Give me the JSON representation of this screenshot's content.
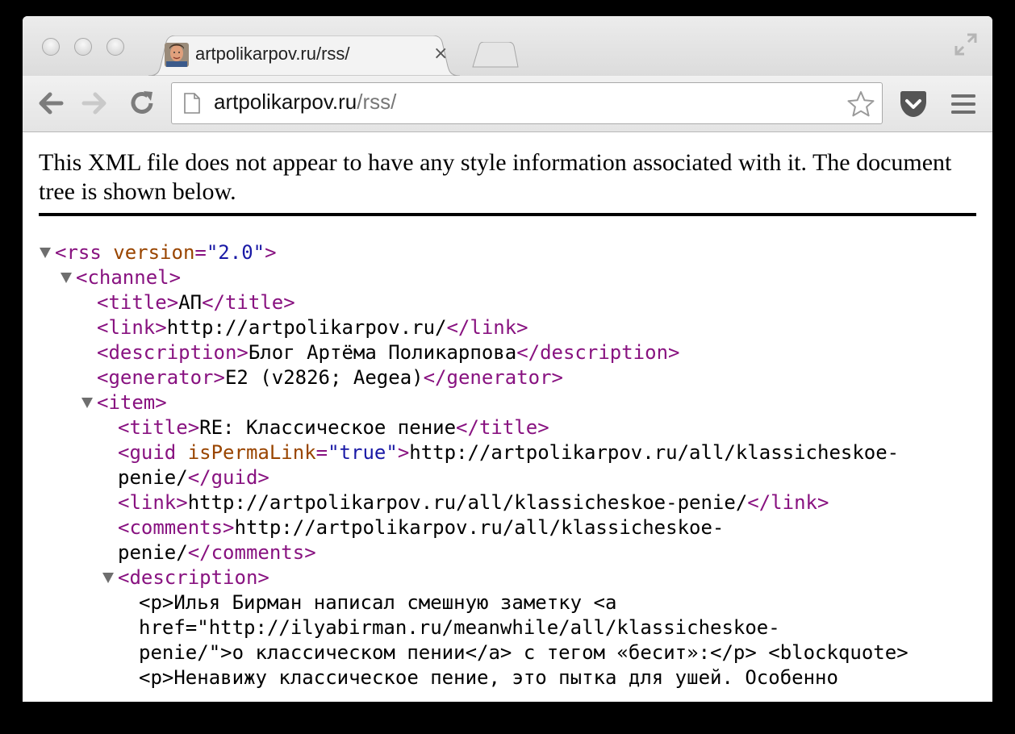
{
  "tab": {
    "title": "artpolikarpov.ru/rss/",
    "close": "×"
  },
  "address": {
    "host": "artpolikarpov.ru",
    "path": "/rss/"
  },
  "notice": "This XML file does not appear to have any style information associated with it. The document tree is shown below.",
  "xml": {
    "rss_open_tag": "<rss",
    "rss_attr": "version",
    "rss_eq": "=",
    "rss_val": "\"2.0\"",
    "rss_close": ">",
    "channel_open": "<channel>",
    "title_open": "<title>",
    "title_text": "АП",
    "title_close": "</title>",
    "link_open": "<link>",
    "link_text": "http://artpolikarpov.ru/",
    "link_close": "</link>",
    "desc_open": "<description>",
    "desc_text": "Блог Артёма Поликарпова",
    "desc_close": "</description>",
    "gen_open": "<generator>",
    "gen_text": "E2 (v2826; Aegea)",
    "gen_close": "</generator>",
    "item_open": "<item>",
    "item_title_open": "<title>",
    "item_title_text": "RE: Классическое пение",
    "item_title_close": "</title>",
    "guid_open": "<guid",
    "guid_attr": "isPermaLink",
    "guid_eq": "=",
    "guid_val": "\"true\"",
    "guid_gt": ">",
    "guid_text_1": "http://artpolikarpov.ru/all/klassicheskoe-",
    "guid_text_2": "penie/",
    "guid_close": "</guid>",
    "item_link_open": "<link>",
    "item_link_text": "http://artpolikarpov.ru/all/klassicheskoe-penie/",
    "item_link_close": "</link>",
    "comments_open": "<comments>",
    "comments_text_1": "http://artpolikarpov.ru/all/klassicheskoe-",
    "comments_text_2": "penie/",
    "comments_close": "</comments>",
    "item_desc_open": "<description>",
    "body_1": "<p>Илья Бирман написал смешную заметку <a",
    "body_2": "href=\"http://ilyabirman.ru/meanwhile/all/klassicheskoe-",
    "body_3": "penie/\">о классическом пении</a> с тегом «бесит»:</p> <blockquote>",
    "body_4": "<p>Ненавижу классическое пение, это пытка для ушей. Особенно"
  }
}
